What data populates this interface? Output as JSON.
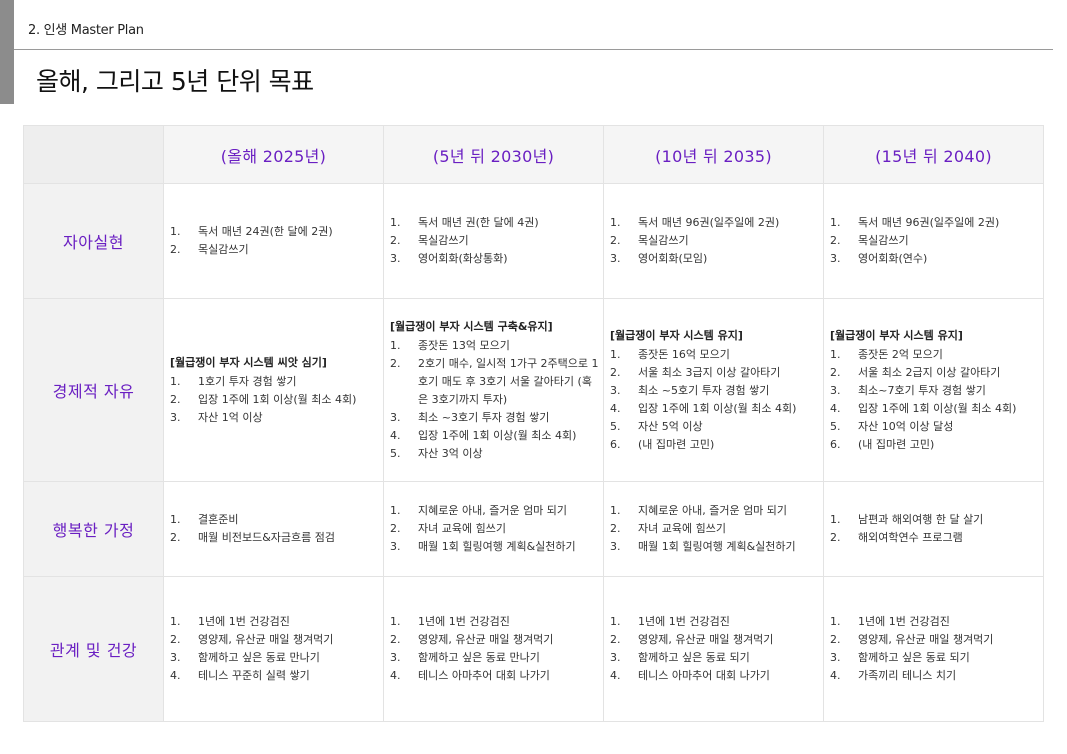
{
  "header": {
    "section_label": "2. 인생 Master Plan",
    "title": "올해, 그리고 5년 단위 목표"
  },
  "columns": [
    "(올해 2025년)",
    "(5년 뒤 2030년)",
    "(10년 뒤 2035)",
    "(15년 뒤 2040)"
  ],
  "rows": [
    {
      "label": "자아실현",
      "cells": [
        {
          "title": "",
          "items": [
            {
              "n": "1.",
              "t": "독서 매년 24권(한 달에 2권)"
            },
            {
              "n": "2.",
              "t": "목실감쓰기"
            }
          ]
        },
        {
          "title": "",
          "items": [
            {
              "n": "1.",
              "t": "독서 매년 권(한 달에 4권)"
            },
            {
              "n": "2.",
              "t": "목실감쓰기"
            },
            {
              "n": "3.",
              "t": "영어회화(화상통화)"
            }
          ]
        },
        {
          "title": "",
          "items": [
            {
              "n": "1.",
              "t": "독서 매년 96권(일주일에 2권)"
            },
            {
              "n": "2.",
              "t": "목실감쓰기"
            },
            {
              "n": "3.",
              "t": "영어회화(모임)"
            }
          ]
        },
        {
          "title": "",
          "items": [
            {
              "n": "1.",
              "t": "독서 매년 96권(일주일에 2권)"
            },
            {
              "n": "2.",
              "t": "목실감쓰기"
            },
            {
              "n": "3.",
              "t": "영어회화(연수)"
            }
          ]
        }
      ]
    },
    {
      "label": "경제적 자유",
      "cells": [
        {
          "title": "[월급쟁이 부자 시스템 씨앗 심기]",
          "items": [
            {
              "n": "1.",
              "t": "1호기 투자 경험 쌓기"
            },
            {
              "n": "2.",
              "t": "입장 1주에 1회 이상(월 최소 4회)"
            },
            {
              "n": "3.",
              "t": "자산 1억 이상"
            }
          ]
        },
        {
          "title": "[월급쟁이 부자 시스템 구축&유지]",
          "items": [
            {
              "n": "1.",
              "t": "종잣돈 13억 모으기"
            },
            {
              "n": "2.",
              "t": "2호기 매수, 일시적 1가구 2주택으로 1호기 매도 후 3호기 서울 갈아타기 (혹은 3호기까지 투자)"
            },
            {
              "n": "3.",
              "t": "최소 ~3호기 투자 경험 쌓기"
            },
            {
              "n": "4.",
              "t": "입장 1주에 1회 이상(월 최소 4회)"
            },
            {
              "n": "5.",
              "t": "자산 3억 이상"
            }
          ]
        },
        {
          "title": "[월급쟁이 부자 시스템 유지]",
          "items": [
            {
              "n": "1.",
              "t": "종잣돈 16억 모으기"
            },
            {
              "n": "2.",
              "t": "서울 최소 3급지 이상 갈아타기"
            },
            {
              "n": "3.",
              "t": "최소 ~5호기 투자 경험 쌓기"
            },
            {
              "n": "4.",
              "t": "입장 1주에 1회 이상(월 최소 4회)"
            },
            {
              "n": "5.",
              "t": "자산 5억 이상"
            },
            {
              "n": "6.",
              "t": "(내 집마련 고민)"
            }
          ]
        },
        {
          "title": "[월급쟁이 부자 시스템 유지]",
          "items": [
            {
              "n": "1.",
              "t": "종잣돈 2억 모으기"
            },
            {
              "n": "2.",
              "t": "서울 최소 2급지 이상 갈아타기"
            },
            {
              "n": "3.",
              "t": "최소~7호기 투자 경험 쌓기"
            },
            {
              "n": "4.",
              "t": "입장 1주에 1회 이상(월 최소 4회)"
            },
            {
              "n": "5.",
              "t": "자산 10억 이상 달성"
            },
            {
              "n": "6.",
              "t": "(내 집마련 고민)"
            }
          ]
        }
      ]
    },
    {
      "label": "행복한 가정",
      "cells": [
        {
          "title": "",
          "items": [
            {
              "n": "1.",
              "t": "결혼준비"
            },
            {
              "n": "2.",
              "t": "매월 비전보드&자금흐름 점검"
            }
          ]
        },
        {
          "title": "",
          "items": [
            {
              "n": "1.",
              "t": "지혜로운 아내, 즐거운 엄마 되기"
            },
            {
              "n": "2.",
              "t": "자녀 교육에 힘쓰기"
            },
            {
              "n": "3.",
              "t": "매월 1회 힐링여행 계획&실천하기"
            }
          ]
        },
        {
          "title": "",
          "items": [
            {
              "n": "1.",
              "t": "지혜로운 아내, 즐거운 엄마 되기"
            },
            {
              "n": "2.",
              "t": "자녀 교육에 힘쓰기"
            },
            {
              "n": "3.",
              "t": "매월 1회 힐링여행 계획&실천하기"
            }
          ]
        },
        {
          "title": "",
          "items": [
            {
              "n": "1.",
              "t": "남편과 해외여행 한 달 살기"
            },
            {
              "n": "2.",
              "t": "해외여학연수 프로그램"
            }
          ]
        }
      ]
    },
    {
      "label": "관계 및 건강",
      "cells": [
        {
          "title": "",
          "items": [
            {
              "n": "1.",
              "t": "1년에 1번 건강검진"
            },
            {
              "n": "2.",
              "t": "영양제, 유산균 매일 챙겨먹기"
            },
            {
              "n": "3.",
              "t": "함께하고 싶은 동료 만나기"
            },
            {
              "n": "4.",
              "t": "테니스 꾸준히 실력 쌓기"
            }
          ]
        },
        {
          "title": "",
          "items": [
            {
              "n": "1.",
              "t": "1년에 1번 건강검진"
            },
            {
              "n": "2.",
              "t": "영양제, 유산균 매일 챙겨먹기"
            },
            {
              "n": "3.",
              "t": "함께하고 싶은 동료 만나기"
            },
            {
              "n": "4.",
              "t": "테니스 아마추어 대회 나가기"
            }
          ]
        },
        {
          "title": "",
          "items": [
            {
              "n": "1.",
              "t": "1년에 1번 건강검진"
            },
            {
              "n": "2.",
              "t": "영양제, 유산균 매일 챙겨먹기"
            },
            {
              "n": "3.",
              "t": "함께하고 싶은 동료 되기"
            },
            {
              "n": "4.",
              "t": "테니스 아마추어 대회 나가기"
            }
          ]
        },
        {
          "title": "",
          "items": [
            {
              "n": "1.",
              "t": "1년에 1번 건강검진"
            },
            {
              "n": "2.",
              "t": "영양제, 유산균 매일 챙겨먹기"
            },
            {
              "n": "3.",
              "t": "함께하고 싶은 동료 되기"
            },
            {
              "n": "4.",
              "t": "가족끼리 테니스 치기"
            }
          ]
        }
      ]
    }
  ]
}
